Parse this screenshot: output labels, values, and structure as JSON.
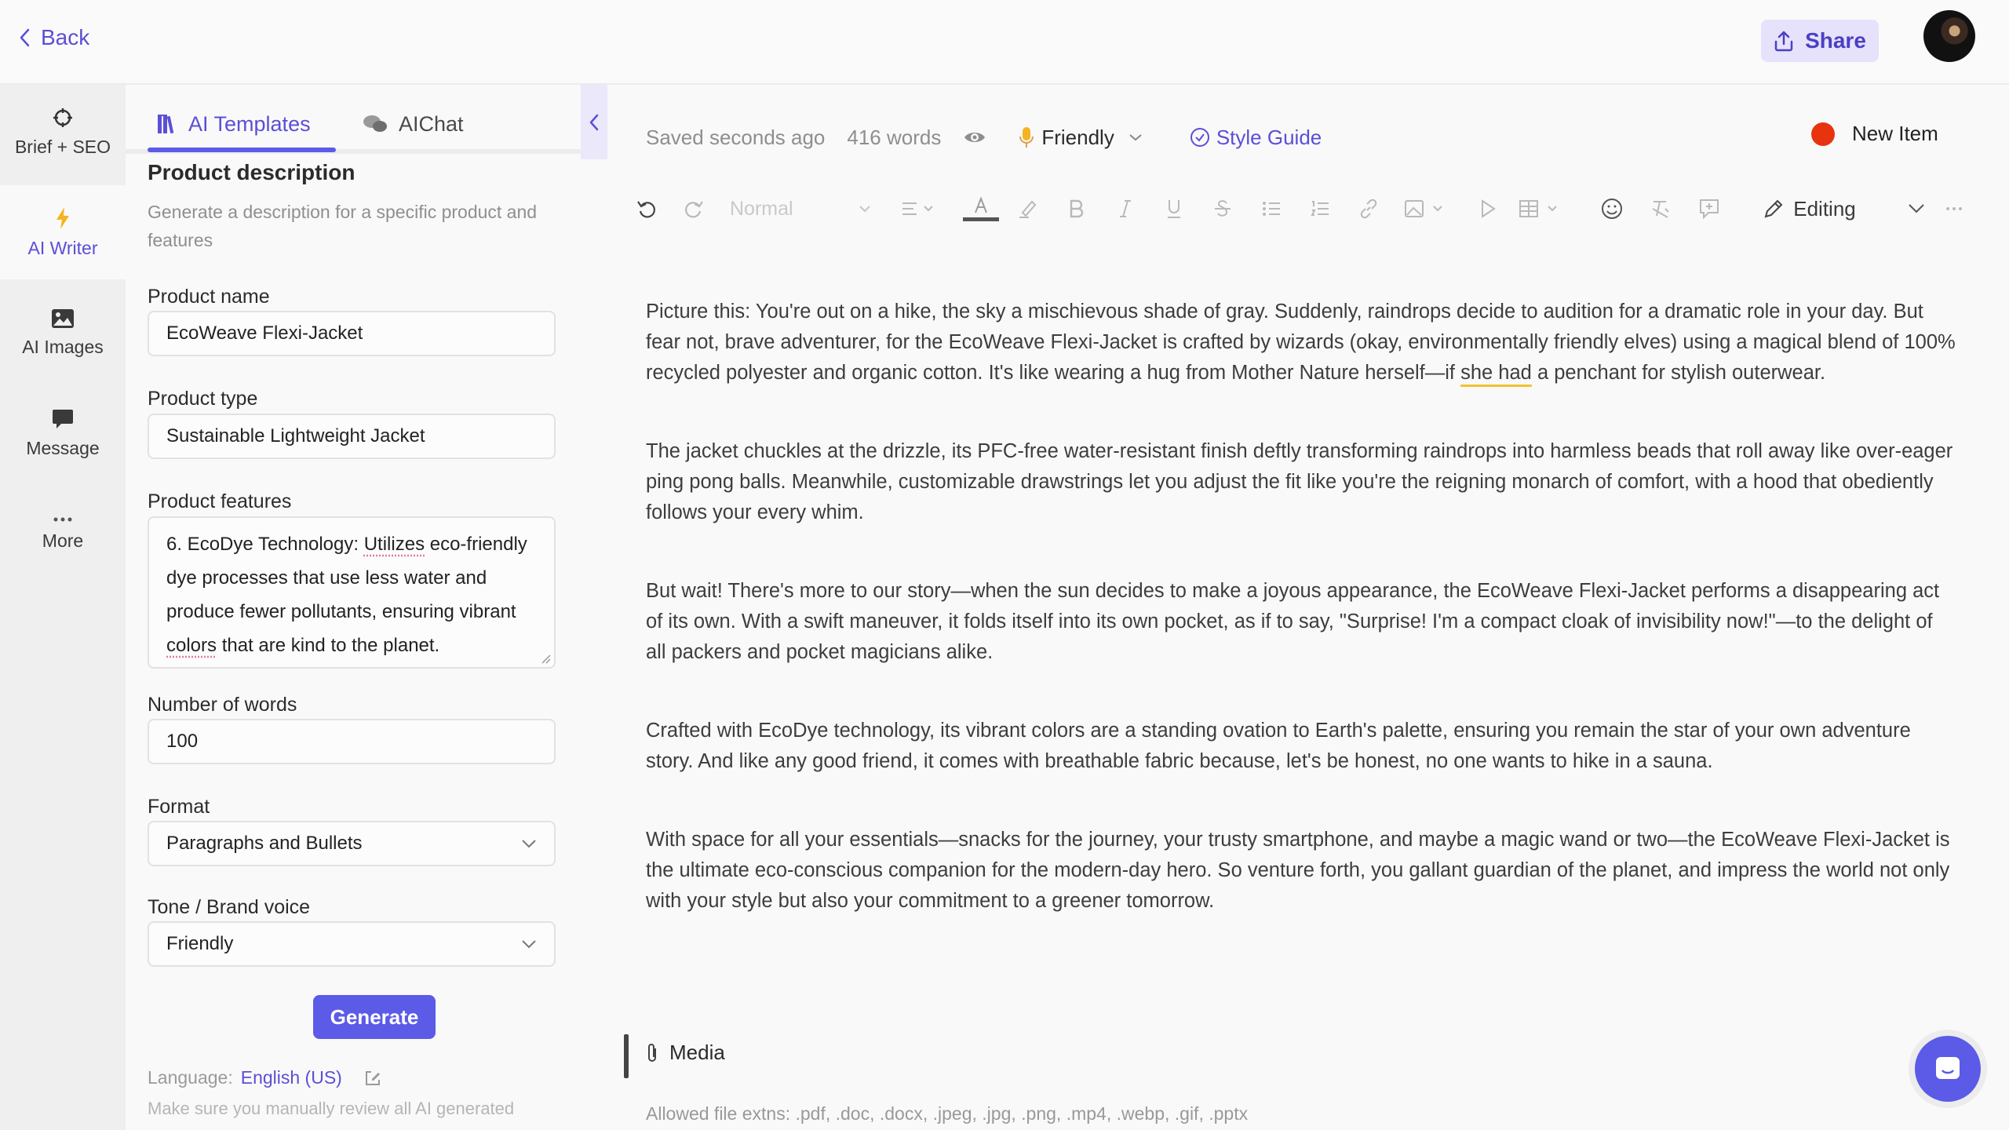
{
  "topbar": {
    "back_label": "Back",
    "share_label": "Share"
  },
  "rail": {
    "items": [
      {
        "label": "Brief + SEO",
        "icon": "target-icon",
        "active": false
      },
      {
        "label": "AI Writer",
        "icon": "lightning-icon",
        "active": true
      },
      {
        "label": "AI Images",
        "icon": "image-icon",
        "active": false
      },
      {
        "label": "Message",
        "icon": "message-icon",
        "active": false
      },
      {
        "label": "More",
        "icon": "more-icon",
        "active": false
      }
    ]
  },
  "panel": {
    "tabs": [
      {
        "label": "AI Templates",
        "icon": "templates-icon",
        "active": true
      },
      {
        "label": "AIChat",
        "icon": "chat-bubbles-icon",
        "active": false
      }
    ],
    "template_title": "Product description",
    "template_desc": "Generate a description for a specific product and features",
    "fields": {
      "product_name": {
        "label": "Product name",
        "value": "EcoWeave Flexi-Jacket"
      },
      "product_type": {
        "label": "Product type",
        "value": "Sustainable Lightweight Jacket"
      },
      "product_features": {
        "label": "Product features",
        "value_prefix": "6. EcoDye Technology: ",
        "value_word1": "Utilizes",
        "value_mid": " eco-friendly dye processes that use less water and produce fewer pollutants, ensuring vibrant ",
        "value_word2": "colors",
        "value_suffix": " that are kind to the planet."
      },
      "number_of_words": {
        "label": "Number of words",
        "value": "100"
      },
      "format": {
        "label": "Format",
        "value": "Paragraphs and Bullets"
      },
      "tone": {
        "label": "Tone / Brand voice",
        "value": "Friendly"
      }
    },
    "generate_label": "Generate",
    "language_label": "Language:",
    "language_value": "English (US)",
    "note": "Make sure you manually review all AI generated"
  },
  "editor": {
    "saved_status": "Saved seconds ago",
    "word_count": "416 words",
    "tone_label": "Friendly",
    "style_guide_label": "Style Guide",
    "item_status": "New Item",
    "status_color": "#e8330f",
    "toolbar": {
      "paragraph_style": "Normal",
      "mode_label": "Editing"
    },
    "paragraphs": [
      {
        "before": "Picture this: You're out on a hike, the sky a mischievous shade of gray. Suddenly, raindrops decide to audition for a dramatic role in your day. But fear not, brave adventurer, for the EcoWeave Flexi-Jacket is crafted by wizards (okay, environmentally friendly elves) using a magical blend of 100% recycled polyester and organic cotton. It's like wearing a hug from Mother Nature herself—if ",
        "highlight": "she had",
        "after": " a penchant for stylish outerwear."
      },
      {
        "text": "The jacket chuckles at the drizzle, its PFC-free water-resistant finish deftly transforming raindrops into harmless beads that roll away like over-eager ping pong balls. Meanwhile, customizable drawstrings let you adjust the fit like you're the reigning monarch of comfort, with a hood that obediently follows your every whim."
      },
      {
        "text": "But wait! There's more to our story—when the sun decides to make a joyous appearance, the EcoWeave Flexi-Jacket performs a disappearing act of its own. With a swift maneuver, it folds itself into its own pocket, as if to say, \"Surprise! I'm a compact cloak of invisibility now!\"—to the delight of all packers and pocket magicians alike."
      },
      {
        "text": "Crafted with EcoDye technology, its vibrant colors are a standing ovation to Earth's palette, ensuring you remain the star of your own adventure story. And like any good friend, it comes with breathable fabric because, let's be honest, no one wants to hike in a sauna."
      },
      {
        "text": "With space for all your essentials—snacks for the journey, your trusty smartphone, and maybe a magic wand or two—the EcoWeave Flexi-Jacket is the ultimate eco-conscious companion for the modern-day hero. So venture forth, you gallant guardian of the planet, and impress the world not only with your style but also your commitment to a greener tomorrow."
      }
    ],
    "media_label": "Media",
    "allowed_ext": "Allowed file extns: .pdf, .doc, .docx, .jpeg, .jpg, .png, .mp4, .webp, .gif, .pptx"
  }
}
